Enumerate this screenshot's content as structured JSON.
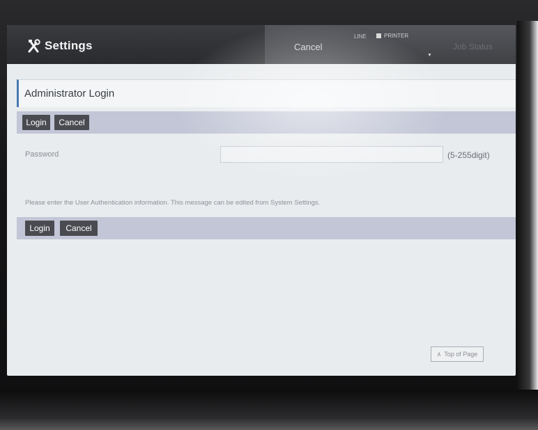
{
  "header": {
    "app_title": "Settings",
    "tabs": {
      "cancel_label": "Cancel",
      "job_status_label": "Job Status"
    },
    "status": {
      "line_label": "LINE",
      "printer_label": "PRINTER"
    }
  },
  "page": {
    "title": "Administrator Login"
  },
  "actions_top": {
    "login_label": "Login",
    "cancel_label": "Cancel"
  },
  "form": {
    "password_label": "Password",
    "password_value": "",
    "password_hint": "(5-255digit)"
  },
  "message": "Please enter the User Authentication information. This message can be edited from System Settings.",
  "actions_bottom": {
    "login_label": "Login",
    "cancel_label": "Cancel"
  },
  "footer": {
    "top_of_page_label": "Top of Page"
  },
  "icons": {
    "tools": "tools-icon",
    "printer": "printer-icon",
    "chevron": "chevron-down-icon",
    "up": "chevron-up-icon"
  },
  "colors": {
    "header_bg": "#2a2b2e",
    "action_bar": "#c2c6d6",
    "button_bg": "#4a4b50",
    "title_accent": "#4a7ab0"
  }
}
